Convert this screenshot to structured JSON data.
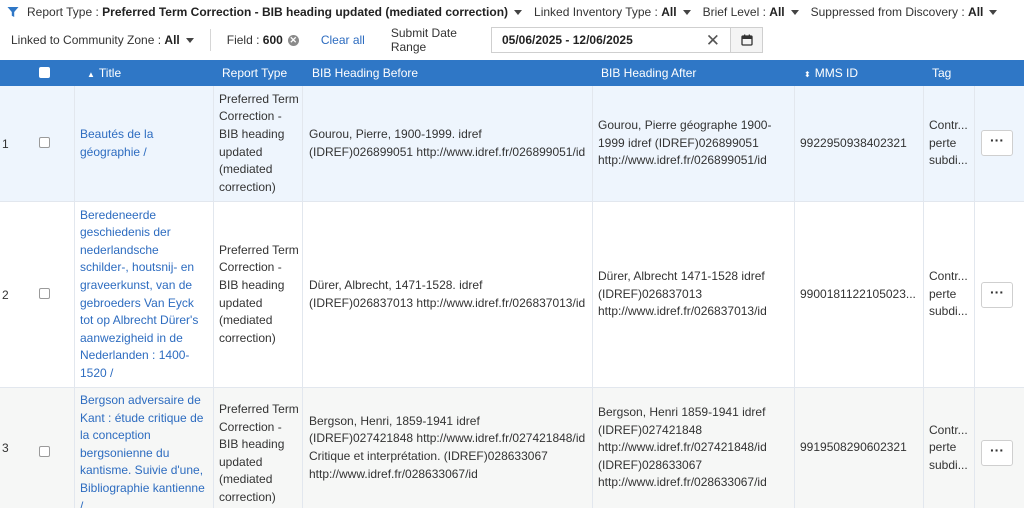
{
  "filters": {
    "row1": [
      {
        "label": "Report Type :",
        "value": "Preferred Term Correction - BIB heading updated (mediated correction)"
      },
      {
        "label": "Linked Inventory Type :",
        "value": "All"
      },
      {
        "label": "Brief Level :",
        "value": "All"
      },
      {
        "label": "Suppressed from Discovery :",
        "value": "All"
      }
    ],
    "community_zone": {
      "label": "Linked to Community Zone :",
      "value": "All"
    },
    "field_chip": {
      "label": "Field :",
      "value": "600"
    },
    "clear_all": "Clear all",
    "submit_date_label": "Submit Date Range",
    "date_range": "05/06/2025 - 12/06/2025"
  },
  "table": {
    "columns": {
      "title": "Title",
      "report_type": "Report Type",
      "before": "BIB Heading Before",
      "after": "BIB Heading After",
      "mms": "MMS ID",
      "tag": "Tag"
    },
    "rows": [
      {
        "num": "1",
        "title": "Beautés de la géographie /",
        "report_type": "Preferred Term Correction - BIB heading updated (mediated correction)",
        "before": "Gourou, Pierre, 1900-1999. idref (IDREF)026899051 http://www.idref.fr/026899051/id",
        "after": "Gourou, Pierre géographe 1900-1999 idref (IDREF)026899051 http://www.idref.fr/026899051/id",
        "mms": "9922950938402321",
        "tag": "Contr... perte subdi...",
        "menu": "···"
      },
      {
        "num": "2",
        "title": "Beredeneerde geschiedenis der nederlandsche schilder-, houtsnij- en graveerkunst, van de gebroeders Van Eyck tot op Albrecht Dürer's aanwezigheid in de Nederlanden : 1400-1520 /",
        "report_type": "Preferred Term Correction - BIB heading updated (mediated correction)",
        "before": "Dürer, Albrecht, 1471-1528. idref (IDREF)026837013 http://www.idref.fr/026837013/id",
        "after": "Dürer, Albrecht 1471-1528 idref (IDREF)026837013 http://www.idref.fr/026837013/id",
        "mms": "9900181122105023...",
        "tag": "Contr... perte subdi...",
        "menu": "···"
      },
      {
        "num": "3",
        "title": "Bergson adversaire de Kant : étude critique de la conception bergsonienne du kantisme. Suivie d'une, Bibliographie kantienne /",
        "report_type": "Preferred Term Correction - BIB heading updated (mediated correction)",
        "before": "Bergson, Henri, 1859-1941 idref (IDREF)027421848 http://www.idref.fr/027421848/id Critique et interprétation. (IDREF)028633067 http://www.idref.fr/028633067/id",
        "after": "Bergson, Henri 1859-1941 idref (IDREF)027421848 http://www.idref.fr/027421848/id (IDREF)028633067 http://www.idref.fr/028633067/id",
        "mms": "9919508290602321",
        "tag": "Contr... perte subdi...",
        "menu": "···"
      }
    ]
  },
  "colors": {
    "header_bg": "#2f77c6",
    "link": "#2d6cc0",
    "row1_bg": "#eef5fd",
    "row3_bg": "#f6f7f6"
  },
  "icons": [
    "funnel-icon",
    "chevron-down-icon",
    "close-circle-icon",
    "clear-x-icon",
    "calendar-icon",
    "sort-asc-icon",
    "sort-both-icon",
    "more-options-icon"
  ]
}
